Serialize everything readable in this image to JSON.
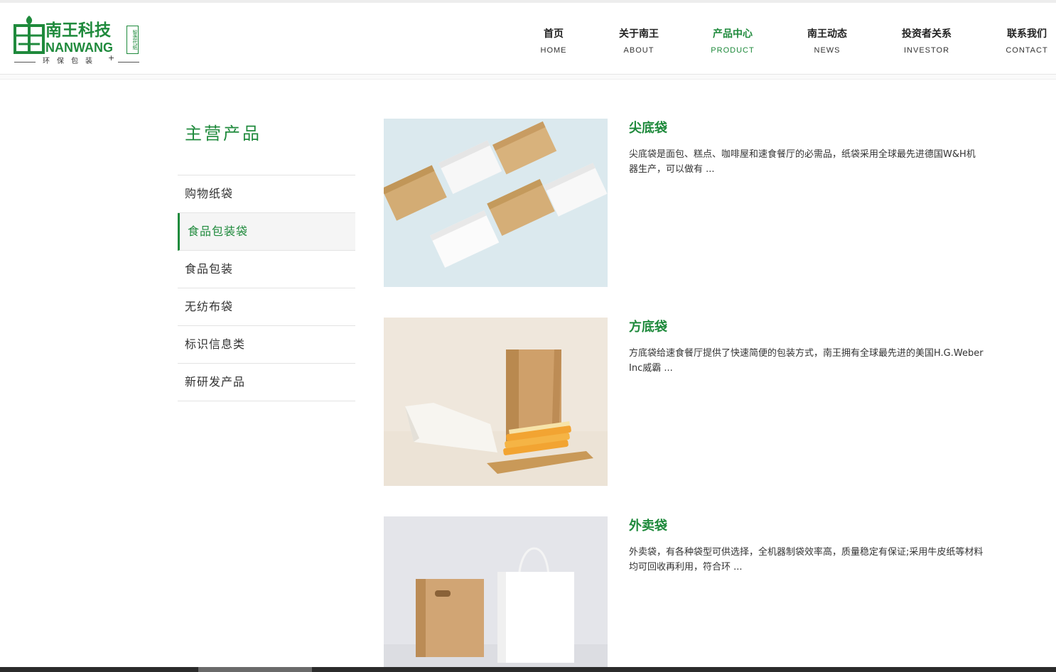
{
  "logo": {
    "cn": "南王科技",
    "en": "NANWANG",
    "tag": "智造代纸",
    "slogan": "环保包装",
    "plus": "+"
  },
  "nav": [
    {
      "cn": "首页",
      "en": "HOME",
      "active": false
    },
    {
      "cn": "关于南王",
      "en": "ABOUT",
      "active": false
    },
    {
      "cn": "产品中心",
      "en": "PRODUCT",
      "active": true
    },
    {
      "cn": "南王动态",
      "en": "NEWS",
      "active": false
    },
    {
      "cn": "投资者关系",
      "en": "INVESTOR",
      "active": false
    },
    {
      "cn": "联系我们",
      "en": "CONTACT",
      "active": false
    }
  ],
  "sidebar": {
    "title": "主营产品",
    "items": [
      {
        "label": "购物纸袋",
        "active": false
      },
      {
        "label": "食品包装袋",
        "active": true
      },
      {
        "label": "食品包装",
        "active": false
      },
      {
        "label": "无纺布袋",
        "active": false
      },
      {
        "label": "标识信息类",
        "active": false
      },
      {
        "label": "新研发产品",
        "active": false
      }
    ]
  },
  "products": [
    {
      "name": "尖底袋",
      "desc": "尖底袋是面包、糕点、咖啡屋和速食餐厅的必需品，纸袋采用全球最先进德国W&H机器生产，可以做有 ...",
      "image": "paper-bags-on-light-blue"
    },
    {
      "name": "方底袋",
      "desc": "方底袋给速食餐厅提供了快速简便的包装方式，南王拥有全球最先进的美国H.G.Weber Inc威霸 ...",
      "image": "square-bottom-bags-with-bread"
    },
    {
      "name": "外卖袋",
      "desc": "外卖袋，有各种袋型可供选择，全机器制袋效率高，质量稳定有保证;采用牛皮纸等材料均可回收再利用，符合环 ...",
      "image": "takeaway-paper-bags"
    }
  ],
  "colors": {
    "brand_green": "#1f8a3c",
    "text": "#333333",
    "kraft": "#d8b27c"
  }
}
